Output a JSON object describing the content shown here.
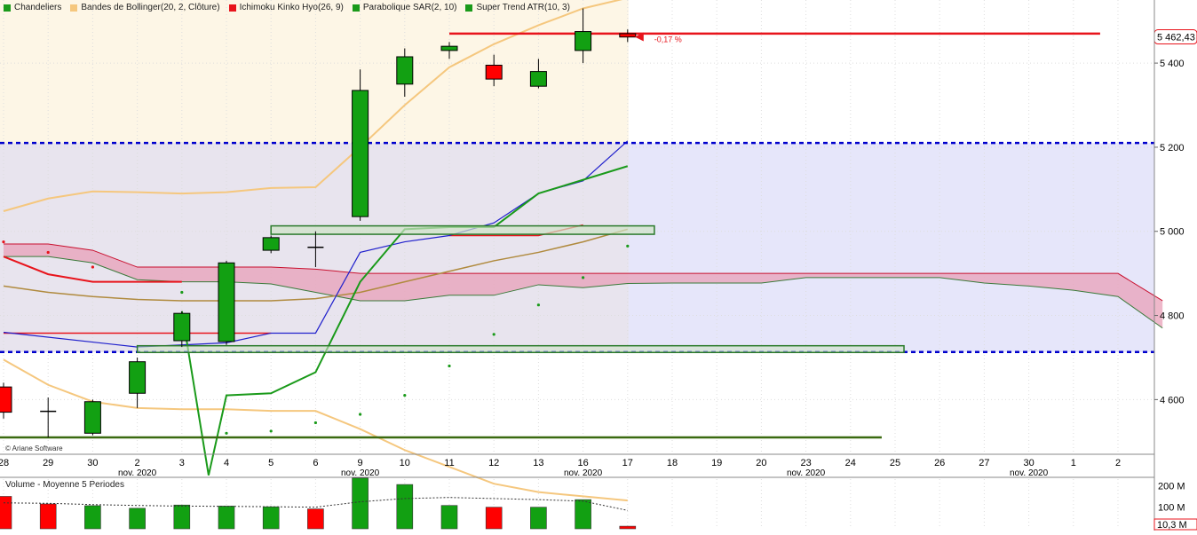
{
  "legend": [
    {
      "label": "Chandeliers",
      "color": "#1a9a1a"
    },
    {
      "label": "Bandes de Bollinger(20, 2, Clôture)",
      "color": "#f5c77e"
    },
    {
      "label": "Ichimoku Kinko Hyo(26, 9)",
      "color": "#e8141c"
    },
    {
      "label": "Parabolique SAR(2, 10)",
      "color": "#1a9a1a"
    },
    {
      "label": "Super Trend ATR(10, 3)",
      "color": "#1a9a1a"
    }
  ],
  "volume_legend": "Volume  - Moyenne 5 Periodes",
  "copyright": "© Ariane Software",
  "price_tag": "5 462,43",
  "variation_label": "-0,17 %",
  "colors": {
    "up": "#12a012",
    "down": "#ff0000",
    "level_line": "#0000cc",
    "resistance": "#e8141c",
    "cloud": "#e8a0b8",
    "bollinger": "#f5c77e"
  },
  "chart_data": {
    "type": "candlestick",
    "x_ticks": [
      "28",
      "29",
      "30",
      "2",
      "3",
      "4",
      "5",
      "6",
      "9",
      "10",
      "11",
      "12",
      "13",
      "16",
      "17",
      "18",
      "19",
      "20",
      "23",
      "24",
      "25",
      "26",
      "27",
      "30",
      "1",
      "2"
    ],
    "month_labels": [
      "nov. 2020",
      "nov. 2020",
      "nov. 2020",
      "nov. 2020",
      "nov. 2020"
    ],
    "y_ticks": [
      "5 400",
      "5 200",
      "5 000",
      "4 800",
      "4 600"
    ],
    "y_tick_values": [
      5400,
      5200,
      5000,
      4800,
      4600
    ],
    "ylim": [
      4470,
      5550
    ],
    "candles": [
      {
        "d": "28",
        "o": 4630,
        "h": 4640,
        "l": 4555,
        "c": 4570
      },
      {
        "d": "29",
        "o": 4570,
        "h": 4605,
        "l": 4510,
        "c": 4572
      },
      {
        "d": "30",
        "o": 4520,
        "h": 4600,
        "l": 4515,
        "c": 4595
      },
      {
        "d": "2",
        "o": 4615,
        "h": 4700,
        "l": 4580,
        "c": 4690
      },
      {
        "d": "3",
        "o": 4740,
        "h": 4810,
        "l": 4725,
        "c": 4805
      },
      {
        "d": "4",
        "o": 4738,
        "h": 4930,
        "l": 4730,
        "c": 4925
      },
      {
        "d": "5",
        "o": 4955,
        "h": 4990,
        "l": 4948,
        "c": 4985
      },
      {
        "d": "6",
        "o": 4960,
        "h": 5000,
        "l": 4915,
        "c": 4962
      },
      {
        "d": "9",
        "o": 5035,
        "h": 5385,
        "l": 5025,
        "c": 5335
      },
      {
        "d": "10",
        "o": 5350,
        "h": 5435,
        "l": 5320,
        "c": 5415
      },
      {
        "d": "11",
        "o": 5430,
        "h": 5450,
        "l": 5410,
        "c": 5440
      },
      {
        "d": "12",
        "o": 5395,
        "h": 5420,
        "l": 5345,
        "c": 5362
      },
      {
        "d": "13",
        "o": 5345,
        "h": 5410,
        "l": 5340,
        "c": 5380
      },
      {
        "d": "16",
        "o": 5430,
        "h": 5530,
        "l": 5400,
        "c": 5475
      },
      {
        "d": "17",
        "o": 5470,
        "h": 5480,
        "l": 5450,
        "c": 5462
      }
    ],
    "horizontal_levels": [
      5210,
      4713
    ],
    "resistance_level": 5470,
    "support_line": 4510,
    "volume": {
      "y_ticks": [
        "200 M",
        "100 M"
      ],
      "y_tick_values": [
        200,
        100
      ],
      "last_label": "10,3 M",
      "ylim": [
        0,
        230
      ],
      "values": [
        150,
        115,
        107,
        95,
        110,
        105,
        102,
        92,
        235,
        205,
        108,
        100,
        100,
        135,
        12
      ],
      "up": [
        false,
        false,
        true,
        true,
        true,
        true,
        true,
        false,
        true,
        true,
        true,
        false,
        true,
        true,
        false
      ],
      "average": [
        120,
        118,
        112,
        108,
        105,
        104,
        102,
        100,
        125,
        140,
        145,
        140,
        135,
        128,
        85
      ]
    }
  }
}
